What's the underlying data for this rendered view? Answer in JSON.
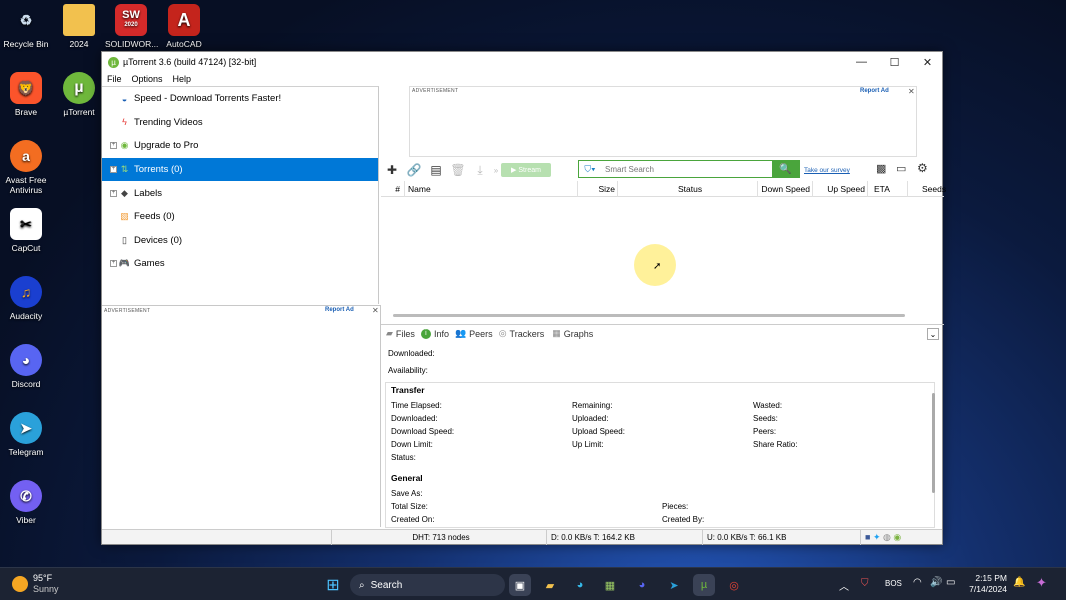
{
  "desktop": {
    "icons": [
      {
        "label": "Recycle Bin",
        "icon": "recycle-bin-icon"
      },
      {
        "label": "2024",
        "icon": "folder-icon"
      },
      {
        "label": "SOLIDWOR...",
        "icon": "solidworks-icon",
        "badge": "2020"
      },
      {
        "label": "AutoCAD",
        "icon": "autocad-icon"
      },
      {
        "label": "Brave",
        "icon": "brave-icon"
      },
      {
        "label": "µTorrent",
        "icon": "utorrent-icon"
      },
      {
        "label": "Avast Free Antivirus",
        "icon": "avast-icon"
      },
      {
        "label": "CapCut",
        "icon": "capcut-icon"
      },
      {
        "label": "Audacity",
        "icon": "audacity-icon"
      },
      {
        "label": "Discord",
        "icon": "discord-icon"
      },
      {
        "label": "Telegram",
        "icon": "telegram-icon"
      },
      {
        "label": "Viber",
        "icon": "viber-icon"
      }
    ]
  },
  "window": {
    "title": "µTorrent 3.6  (build 47124) [32-bit]",
    "menu": [
      "File",
      "Options",
      "Help"
    ]
  },
  "sidebar": {
    "items": [
      {
        "label": "Speed - Download Torrents Faster!",
        "icon": "speed-icon",
        "expander": false
      },
      {
        "label": "Trending Videos",
        "icon": "lightning-icon",
        "expander": false
      },
      {
        "label": "Upgrade to Pro",
        "icon": "utorrent-icon",
        "expander": true
      },
      {
        "label": "Torrents (0)",
        "icon": "torrents-icon",
        "expander": true,
        "selected": true
      },
      {
        "label": "Labels",
        "icon": "label-icon",
        "expander": true
      },
      {
        "label": "Feeds (0)",
        "icon": "rss-icon",
        "expander": false
      },
      {
        "label": "Devices (0)",
        "icon": "device-icon",
        "expander": false
      },
      {
        "label": "Games",
        "icon": "gamepad-icon",
        "expander": true
      }
    ]
  },
  "ads": {
    "label": "ADVERTISEMENT",
    "report": "Report Ad"
  },
  "toolbar": {
    "search_placeholder": "Smart Search",
    "survey_link": "Take our survey",
    "stream_label": "Stream"
  },
  "columns": [
    "#",
    "Name",
    "Size",
    "Status",
    "Down Speed",
    "Up Speed",
    "ETA",
    "Seeds"
  ],
  "detail_tabs": [
    "Files",
    "Info",
    "Peers",
    "Trackers",
    "Graphs"
  ],
  "info": {
    "downloaded": "Downloaded:",
    "availability": "Availability:",
    "transfer_title": "Transfer",
    "transfer": [
      [
        "Time Elapsed:",
        "Remaining:",
        "Wasted:"
      ],
      [
        "Downloaded:",
        "Uploaded:",
        "Seeds:"
      ],
      [
        "Download Speed:",
        "Upload Speed:",
        "Peers:"
      ],
      [
        "Down Limit:",
        "Up Limit:",
        "Share Ratio:"
      ],
      [
        "Status:",
        "",
        ""
      ]
    ],
    "general_title": "General",
    "general": [
      [
        "Save As:",
        ""
      ],
      [
        "Total Size:",
        "Pieces:"
      ],
      [
        "Created On:",
        "Created By:"
      ]
    ]
  },
  "status": {
    "dht": "DHT: 713 nodes",
    "down": "D: 0.0 KB/s T: 164.2 KB",
    "up": "U: 0.0 KB/s T: 66.1 KB"
  },
  "taskbar": {
    "weather_temp": "95°F",
    "weather_desc": "Sunny",
    "search_label": "Search",
    "lang": "BOS",
    "time": "2:15 PM",
    "date": "7/14/2024"
  }
}
